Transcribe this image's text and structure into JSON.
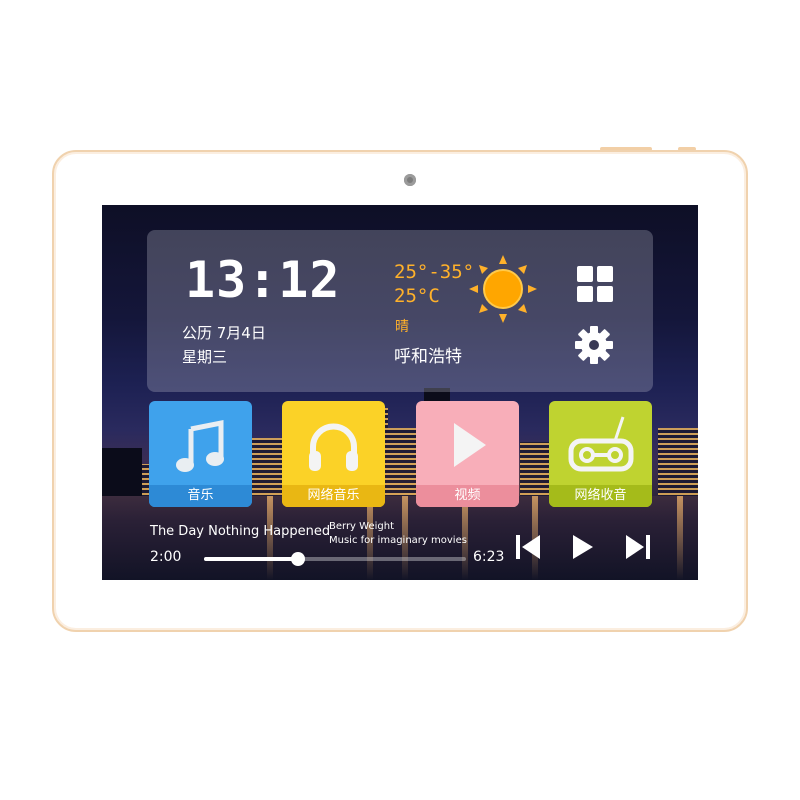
{
  "clock": {
    "time": "13:12",
    "date": "公历  7月4日",
    "weekday": "星期三"
  },
  "weather": {
    "temp_range": "25°-35°",
    "current_temp": "25°C",
    "condition": "晴",
    "city": "呼和浩特",
    "icon": "sun-icon"
  },
  "shortcuts": {
    "apps_icon": "grid-icon",
    "settings_icon": "gear-icon"
  },
  "apps": [
    {
      "label": "音乐",
      "icon": "music-note-icon",
      "color": "#3fa2ec"
    },
    {
      "label": "网络音乐",
      "icon": "headphones-icon",
      "color": "#fbd227"
    },
    {
      "label": "视频",
      "icon": "play-icon",
      "color": "#f8aeb9"
    },
    {
      "label": "网络收音",
      "icon": "radio-icon",
      "color": "#bfd330"
    }
  ],
  "player": {
    "song": "The Day Nothing Happened",
    "artist": "Berry Weight",
    "album": "Music for imaginary movies",
    "elapsed": "2:00",
    "duration": "6:23",
    "progress": 0.36,
    "controls": [
      "previous-icon",
      "play-icon",
      "next-icon"
    ]
  },
  "colors": {
    "accent": "#ffb12a",
    "device_trim": "#f0d2ae"
  }
}
